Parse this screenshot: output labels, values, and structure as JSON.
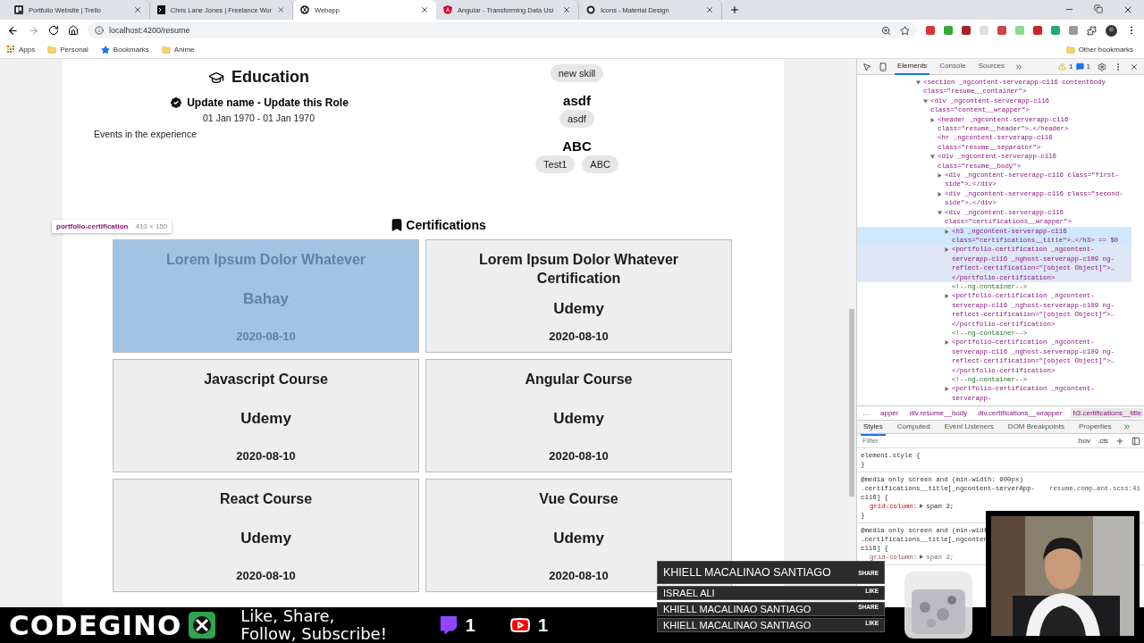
{
  "browser": {
    "tabs": [
      {
        "title": "Portfolio Website | Trello",
        "kind": "board",
        "selected": false
      },
      {
        "title": "Chris Lane Jones | Freelance Wor",
        "kind": "terminal",
        "selected": false
      },
      {
        "title": "Webapp",
        "kind": "logo",
        "selected": true
      },
      {
        "title": "Angular - Transforming Data Usi",
        "kind": "angular",
        "selected": false
      },
      {
        "title": "Icons - Material Design",
        "kind": "circle",
        "selected": false
      }
    ],
    "address": "localhost:4200/resume",
    "bookmarks": [
      {
        "label": "Apps",
        "kind": "apps"
      },
      {
        "label": "Personal",
        "kind": "folder"
      },
      {
        "label": "Bookmarks",
        "kind": "star"
      },
      {
        "label": "Anime",
        "kind": "folder"
      }
    ],
    "other_bookmarks": "Other bookmarks"
  },
  "page": {
    "education": {
      "title": "Education",
      "role": "Update name - Update this Role",
      "dates": "01 Jan 1970 - 01 Jan 1970",
      "description": "Events in the experience"
    },
    "skills": [
      {
        "chips": [
          "new skill"
        ]
      },
      {
        "heading": "asdf",
        "chips": [
          "asdf"
        ]
      },
      {
        "heading": "ABC",
        "chips": [
          "Test1",
          "ABC"
        ]
      }
    ],
    "certifications": {
      "title": "Certifications",
      "tooltip": {
        "name": "portfolio-certification",
        "size": "410 × 150"
      },
      "cards": [
        {
          "title": "Lorem Ipsum Dolor Whatever",
          "issuer": "Bahay",
          "date": "2020-08-10",
          "highlighted": true
        },
        {
          "title": "Lorem Ipsum Dolor Whatever Certification",
          "issuer": "Udemy",
          "date": "2020-08-10",
          "highlighted": false
        },
        {
          "title": "Javascript Course",
          "issuer": "Udemy",
          "date": "2020-08-10",
          "highlighted": false
        },
        {
          "title": "Angular Course",
          "issuer": "Udemy",
          "date": "2020-08-10",
          "highlighted": false
        },
        {
          "title": "React Course",
          "issuer": "Udemy",
          "date": "2020-08-10",
          "highlighted": false
        },
        {
          "title": "Vue Course",
          "issuer": "Udemy",
          "date": "2020-08-10",
          "highlighted": false
        }
      ]
    }
  },
  "devtools": {
    "tabs": [
      {
        "label": "Elements",
        "selected": true
      },
      {
        "label": "Console",
        "selected": false
      },
      {
        "label": "Sources",
        "selected": false
      }
    ],
    "warnings": "1",
    "messages": "1",
    "dom": [
      {
        "kind": "element",
        "text": "<section _ngcontent-serverapp-c116 contentbody class=\"resume__container\">",
        "expanded": true,
        "selected": false,
        "hovered": false,
        "children": [
          {
            "kind": "element",
            "text": "<div _ngcontent-serverapp-c116 class=\"content__wrapper\">",
            "expanded": true,
            "selected": false,
            "hovered": false,
            "children": [
              {
                "kind": "element",
                "text": "<header _ngcontent-serverapp-c116 class=\"resume__header\">…</header>",
                "expanded": false,
                "selected": false,
                "hovered": false
              },
              {
                "kind": "leaf",
                "text": "<hr _ngcontent-serverapp-c116 class=\"resume__separator\">",
                "selected": false,
                "hovered": false
              },
              {
                "kind": "element",
                "text": "<div _ngcontent-serverapp-c116 class=\"resume__body\">",
                "expanded": true,
                "selected": false,
                "hovered": false,
                "children": [
                  {
                    "kind": "element",
                    "text": "<div _ngcontent-serverapp-c116 class=\"first-side\">…</div>",
                    "expanded": false,
                    "selected": false,
                    "hovered": false
                  },
                  {
                    "kind": "element",
                    "text": "<div _ngcontent-serverapp-c116 class=\"second-side\">…</div>",
                    "expanded": false,
                    "selected": false,
                    "hovered": false
                  },
                  {
                    "kind": "element",
                    "text": "<div _ngcontent-serverapp-c116 class=\"certifications__wrapper\">",
                    "expanded": true,
                    "selected": false,
                    "hovered": false,
                    "children": [
                      {
                        "kind": "element",
                        "text": "<h3 _ngcontent-serverapp-c116 class=\"certifications__title\">…</h3> == $0",
                        "expanded": false,
                        "selected": true,
                        "hovered": false
                      },
                      {
                        "kind": "element",
                        "text": "<portfolio-certification _ngcontent-serverapp-c116 _nghost-serverapp-c109 ng-reflect-certification=\"[object Object]\">…</portfolio-certification>",
                        "expanded": false,
                        "selected": false,
                        "hovered": true
                      },
                      {
                        "kind": "comment",
                        "text": "<!--ng-container-->",
                        "selected": false,
                        "hovered": false
                      },
                      {
                        "kind": "element",
                        "text": "<portfolio-certification _ngcontent-serverapp-c116 _nghost-serverapp-c109 ng-reflect-certification=\"[object Object]\">…</portfolio-certification>",
                        "expanded": false,
                        "selected": false,
                        "hovered": false
                      },
                      {
                        "kind": "comment",
                        "text": "<!--ng-container-->",
                        "selected": false,
                        "hovered": false
                      },
                      {
                        "kind": "element",
                        "text": "<portfolio-certification _ngcontent-serverapp-c116 _nghost-serverapp-c109 ng-reflect-certification=\"[object Object]\">…</portfolio-certification>",
                        "expanded": false,
                        "selected": false,
                        "hovered": false
                      },
                      {
                        "kind": "comment",
                        "text": "<!--ng-container-->",
                        "selected": false,
                        "hovered": false
                      },
                      {
                        "kind": "element",
                        "text": "<portfolio-certification _ngcontent-serverapp-",
                        "expanded": false,
                        "selected": false,
                        "hovered": false
                      }
                    ]
                  }
                ]
              }
            ]
          }
        ]
      }
    ],
    "breadcrumbs": [
      {
        "label": "…",
        "selected": false
      },
      {
        "label": "apper",
        "selected": false
      },
      {
        "label": "div.resume__body",
        "selected": false
      },
      {
        "label": "div.certifications__wrapper",
        "selected": false
      },
      {
        "label": "h3.certifications__title",
        "selected": true
      }
    ],
    "style_tabs": [
      {
        "label": "Styles",
        "selected": true
      },
      {
        "label": "Computed",
        "selected": false
      },
      {
        "label": "Event Listeners",
        "selected": false
      },
      {
        "label": "DOM Breakpoints",
        "selected": false
      },
      {
        "label": "Properties",
        "selected": false
      }
    ],
    "filter": {
      "placeholder": "Filter"
    },
    "hov": ":hov",
    "cls": ".cls",
    "rules": [
      {
        "lines": [
          "element.style {",
          "}"
        ]
      },
      {
        "lines": [
          "@media only screen and (min-width: 900px)",
          ".certifications__title[_ngcontent-serverApp-",
          "c116] {"
        ],
        "source": "resume.comp…ent.scss:41",
        "property": "grid-column:",
        "value": "span 2;",
        "overridden": false,
        "closing": "}"
      },
      {
        "lines": [
          "@media only screen and (min-widt",
          ".certifications__title[_ngconten",
          "c116] {"
        ],
        "property": "grid-column:",
        "value": "span 2;",
        "overridden": true
      }
    ]
  },
  "stream": {
    "logo": "CODEGINO",
    "tagline": "Like, Share,\nFollow, Subscribe!",
    "twitch_count": "1",
    "youtube_count": "1",
    "events": [
      {
        "name": "KHIELL MACALINAO SANTIAGO",
        "action": "SHARE",
        "featured": true
      },
      {
        "name": "ISRAEL ALI",
        "action": "LIKE",
        "featured": false
      },
      {
        "name": "KHIELL MACALINAO SANTIAGO",
        "action": "SHARE",
        "featured": false
      },
      {
        "name": "KHIELL MACALINAO SANTIAGO",
        "action": "LIKE",
        "featured": false
      }
    ]
  }
}
